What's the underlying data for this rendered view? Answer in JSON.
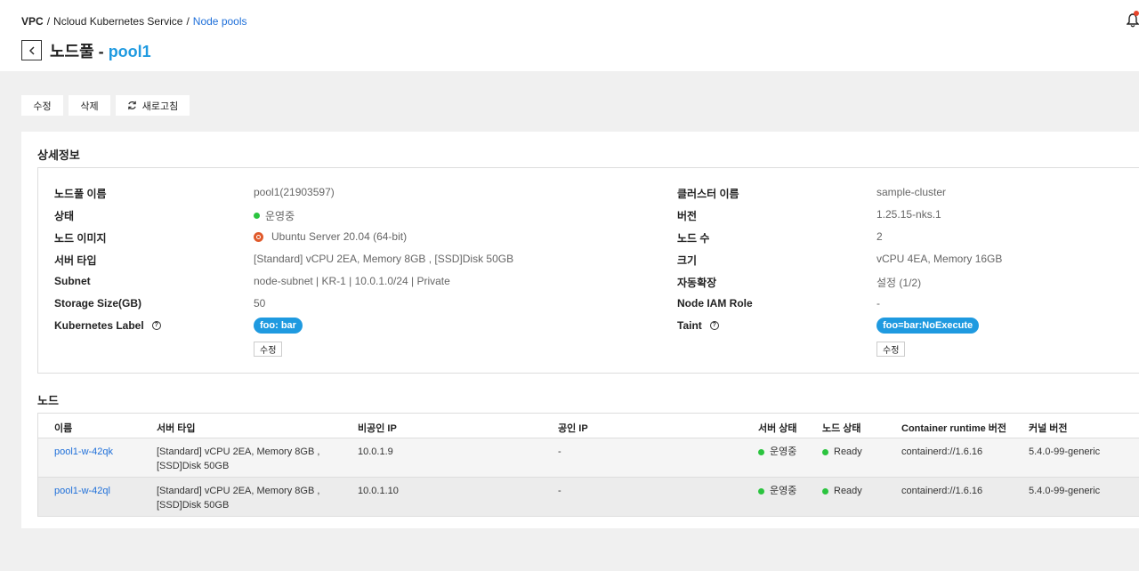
{
  "breadcrumb": [
    "VPC",
    "Ncloud Kubernetes Service",
    "Node pools"
  ],
  "title": {
    "prefix": "노드풀 - ",
    "name": "pool1"
  },
  "toolbar": {
    "edit": "수정",
    "delete": "삭제",
    "refresh": "새로고침"
  },
  "details": {
    "title": "상세정보",
    "left": [
      {
        "label": "노드풀 이름",
        "value": "pool1(21903597)"
      },
      {
        "label": "상태",
        "value": "운영중"
      },
      {
        "label": "노드 이미지",
        "value": "Ubuntu Server 20.04 (64-bit)"
      },
      {
        "label": "서버 타입",
        "value": "[Standard] vCPU 2EA, Memory 8GB , [SSD]Disk 50GB"
      },
      {
        "label": "Subnet",
        "value": "node-subnet | KR-1 | 10.0.1.0/24 | Private"
      },
      {
        "label": "Storage Size(GB)",
        "value": "50"
      },
      {
        "label": "Kubernetes Label",
        "value": "foo: bar",
        "button": "수정"
      }
    ],
    "right": [
      {
        "label": "클러스터 이름",
        "value": "sample-cluster"
      },
      {
        "label": "버전",
        "value": "1.25.15-nks.1"
      },
      {
        "label": "노드 수",
        "value": "2"
      },
      {
        "label": "크기",
        "value": "vCPU 4EA, Memory 16GB"
      },
      {
        "label": "자동확장",
        "value": "설정 (1/2)"
      },
      {
        "label": "Node IAM Role",
        "value": "-"
      },
      {
        "label": "Taint",
        "value": "foo=bar:NoExecute",
        "button": "수정"
      }
    ]
  },
  "nodes": {
    "title": "노드",
    "columns": [
      "이름",
      "서버 타입",
      "비공인 IP",
      "공인 IP",
      "서버 상태",
      "노드 상태",
      "Container runtime 버전",
      "커널 버전"
    ],
    "rows": [
      {
        "name": "pool1-w-42qk",
        "server_type": "[Standard] vCPU 2EA, Memory 8GB , [SSD]Disk 50GB",
        "private_ip": "10.0.1.9",
        "public_ip": "-",
        "server_status": "운영중",
        "node_status": "Ready",
        "runtime": "containerd://1.6.16",
        "kernel": "5.4.0-99-generic"
      },
      {
        "name": "pool1-w-42ql",
        "server_type": "[Standard] vCPU 2EA, Memory 8GB , [SSD]Disk 50GB",
        "private_ip": "10.0.1.10",
        "public_ip": "-",
        "server_status": "운영중",
        "node_status": "Ready",
        "runtime": "containerd://1.6.16",
        "kernel": "5.4.0-99-generic"
      }
    ]
  },
  "colors": {
    "accent": "#1f9ae0",
    "link": "#1e6fd9",
    "status_green": "#2bc43f"
  },
  "icons": [
    "chevron-left-icon",
    "refresh-icon",
    "bell-icon",
    "ubuntu-icon",
    "help-icon",
    "status-dot-icon"
  ]
}
